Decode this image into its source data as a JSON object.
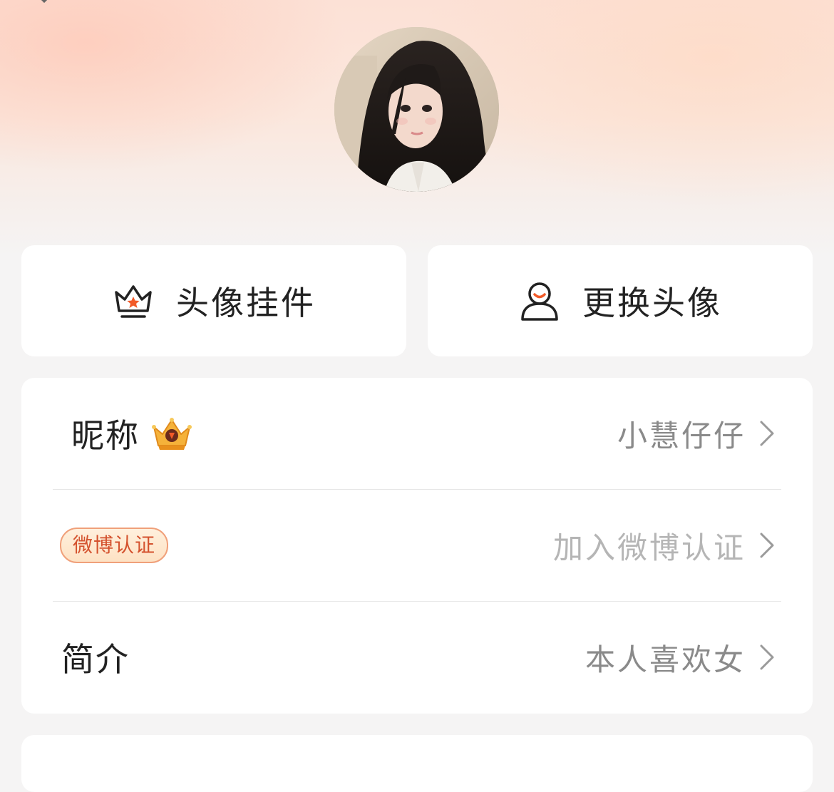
{
  "header": {
    "avatar_alt": "用户头像"
  },
  "actions": {
    "pendant_label": "头像挂件",
    "change_avatar_label": "更换头像"
  },
  "profile": {
    "nickname_label": "昵称",
    "nickname_value": "小慧仔仔",
    "verify_badge_label": "微博认证",
    "verify_value": "加入微博认证",
    "bio_label": "简介",
    "bio_value": "本人喜欢女"
  },
  "icons": {
    "pendant": "crown-outline-icon",
    "change_avatar": "user-silhouette-icon",
    "nickname_badge": "gold-crown-badge-icon",
    "row_arrow": "chevron-right-icon"
  },
  "colors": {
    "accent": "#f25a28",
    "badge_text": "#d4522e",
    "value_text": "#8a8a8a",
    "hint_text": "#b5b5b5",
    "label_text": "#222222"
  }
}
